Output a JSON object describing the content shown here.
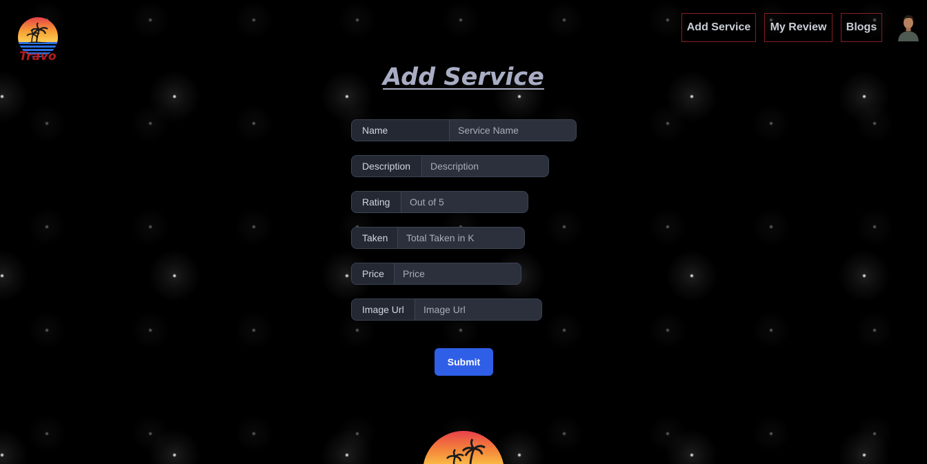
{
  "brand": {
    "name": "Travo",
    "logo_icon": "sunset-palm-logo-icon"
  },
  "nav": {
    "items": [
      {
        "label": "Add Service"
      },
      {
        "label": "My Review"
      },
      {
        "label": "Blogs"
      }
    ],
    "avatar_icon": "user-avatar"
  },
  "page": {
    "title": "Add Service"
  },
  "form": {
    "fields": [
      {
        "label": "Name",
        "placeholder": "Service Name"
      },
      {
        "label": "Description",
        "placeholder": "Description"
      },
      {
        "label": "Rating",
        "placeholder": "Out of 5"
      },
      {
        "label": "Taken",
        "placeholder": "Total Taken in K"
      },
      {
        "label": "Price",
        "placeholder": "Price"
      },
      {
        "label": "Image Url",
        "placeholder": "Image Url"
      }
    ],
    "submit_label": "Submit"
  },
  "colors": {
    "accent_red": "#8b1e1e",
    "brand_red": "#b51d1d",
    "submit_blue": "#2f5fe6",
    "title_color": "#a9adc4"
  }
}
